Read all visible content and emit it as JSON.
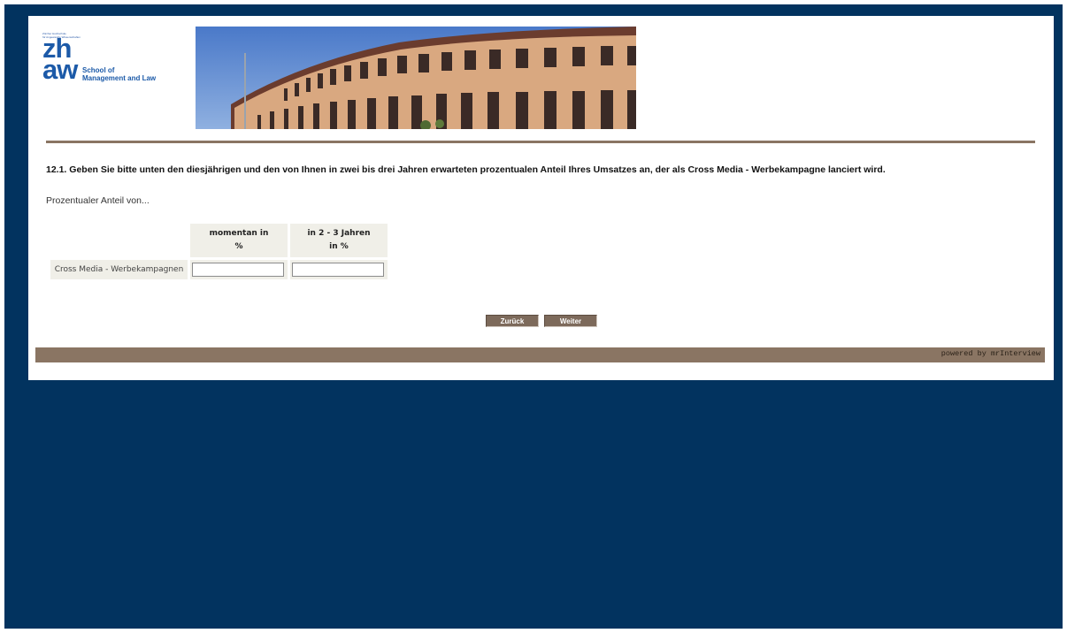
{
  "logo": {
    "small_text": [
      "Zürcher Hochschule",
      "für Angewandte Wissenschaften"
    ],
    "wordmark_top": "zh",
    "wordmark_bottom": "aw",
    "school_line1": "School of",
    "school_line2": "Management and Law"
  },
  "question": {
    "text": "12.1. Geben Sie bitte unten den diesjährigen und den von Ihnen in zwei bis drei Jahren erwarteten prozentualen Anteil Ihres Umsatzes an, der als Cross Media - Werbekampagne lanciert wird.",
    "intro": "Prozentualer Anteil von..."
  },
  "grid": {
    "columns": [
      {
        "line1": "momentan in",
        "line2": "%"
      },
      {
        "line1": "in 2 - 3 Jahren",
        "line2": "in %"
      }
    ],
    "row_label": "Cross Media - Werbekampagnen",
    "values": [
      "",
      ""
    ]
  },
  "buttons": {
    "back": "Zurück",
    "next": "Weiter"
  },
  "footer": {
    "powered": "powered by mrInterview"
  },
  "colors": {
    "background": "#02335f",
    "accent_brown": "#8a7563",
    "button": "#7d6a5b",
    "zhaw_blue": "#1c5aa8"
  }
}
